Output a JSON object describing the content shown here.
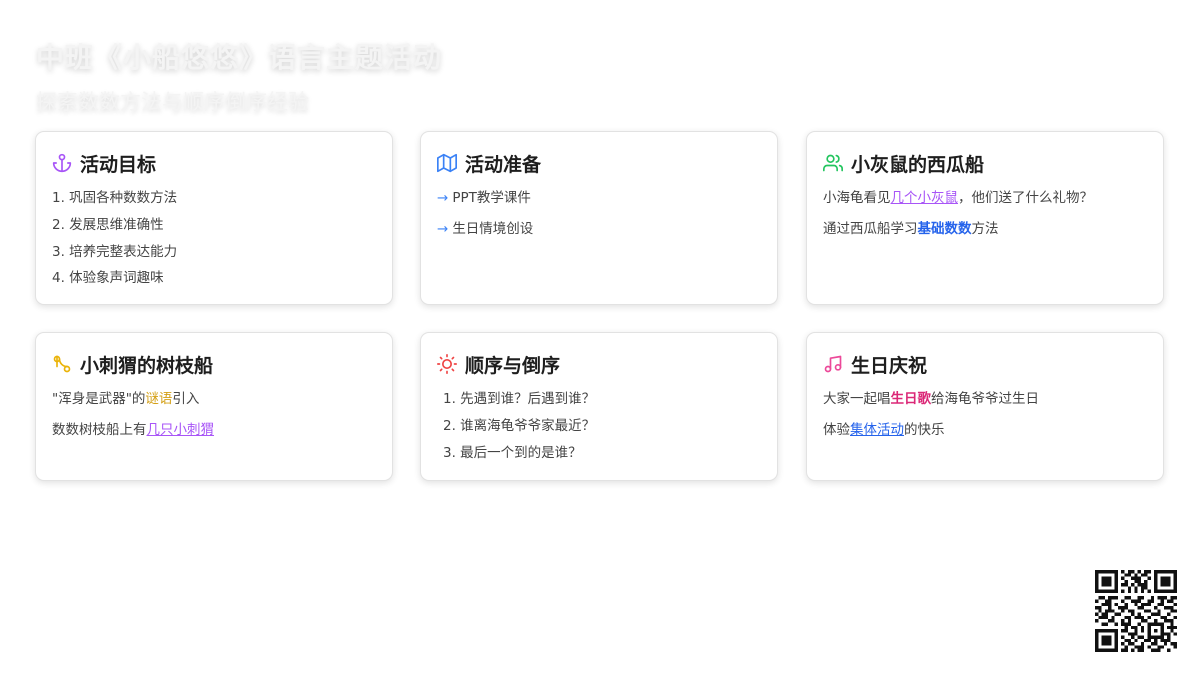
{
  "header": {
    "title": "中班《小船悠悠》语言主题活动",
    "subtitle": "探索数数方法与顺序倒序经验"
  },
  "cards": [
    {
      "title": "活动目标",
      "icon": "anchor-icon",
      "icon_color": "#a855f7",
      "lines": [
        "1. 巩固各种数数方法",
        "2. 发展思维准确性",
        "3. 培养完整表达能力",
        "4. 体验象声词趣味"
      ]
    },
    {
      "title": "活动准备",
      "icon": "map-icon",
      "icon_color": "#3b82f6",
      "lines": [
        "PPT教学课件",
        "生日情境创设"
      ]
    },
    {
      "title": "小灰鼠的西瓜船",
      "icon": "users-icon",
      "icon_color": "#22c55e",
      "line1": {
        "pre": "小海龟看见",
        "hl": "几个小灰鼠",
        "post": "，他们送了什么礼物？"
      },
      "line2": {
        "pre": "通过西瓜船学习",
        "hl": "基础数数",
        "post": "方法"
      }
    },
    {
      "title": "小刺猬的树枝船",
      "icon": "git-branch-icon",
      "icon_color": "#eab308",
      "line1": {
        "pre": "\"浑身是武器\"的",
        "hl": "谜语",
        "post": "引入"
      },
      "line2": {
        "pre": "数数树枝船上有",
        "hl": "几只小刺猬",
        "post": ""
      }
    },
    {
      "title": "顺序与倒序",
      "icon": "sun-icon",
      "icon_color": "#ef4444",
      "lines": [
        "1. 先遇到谁？后遇到谁？",
        "2. 谁离海龟爷爷家最近？",
        "3. 最后一个到的是谁？"
      ]
    },
    {
      "title": "生日庆祝",
      "icon": "music-icon",
      "icon_color": "#ec4899",
      "line1": {
        "pre": "大家一起唱",
        "hl": "生日歌",
        "post": "给海龟爷爷过生日"
      },
      "line2": {
        "pre": "体验",
        "hl": "集体活动",
        "post": "的快乐"
      }
    }
  ],
  "qr": {
    "icon": "qr-code-icon"
  },
  "colors": {
    "purple": "#a855f7",
    "blue": "#2563eb",
    "green": "#22c55e",
    "amber": "#d4a017",
    "red": "#ef4444",
    "pink": "#db2777"
  }
}
